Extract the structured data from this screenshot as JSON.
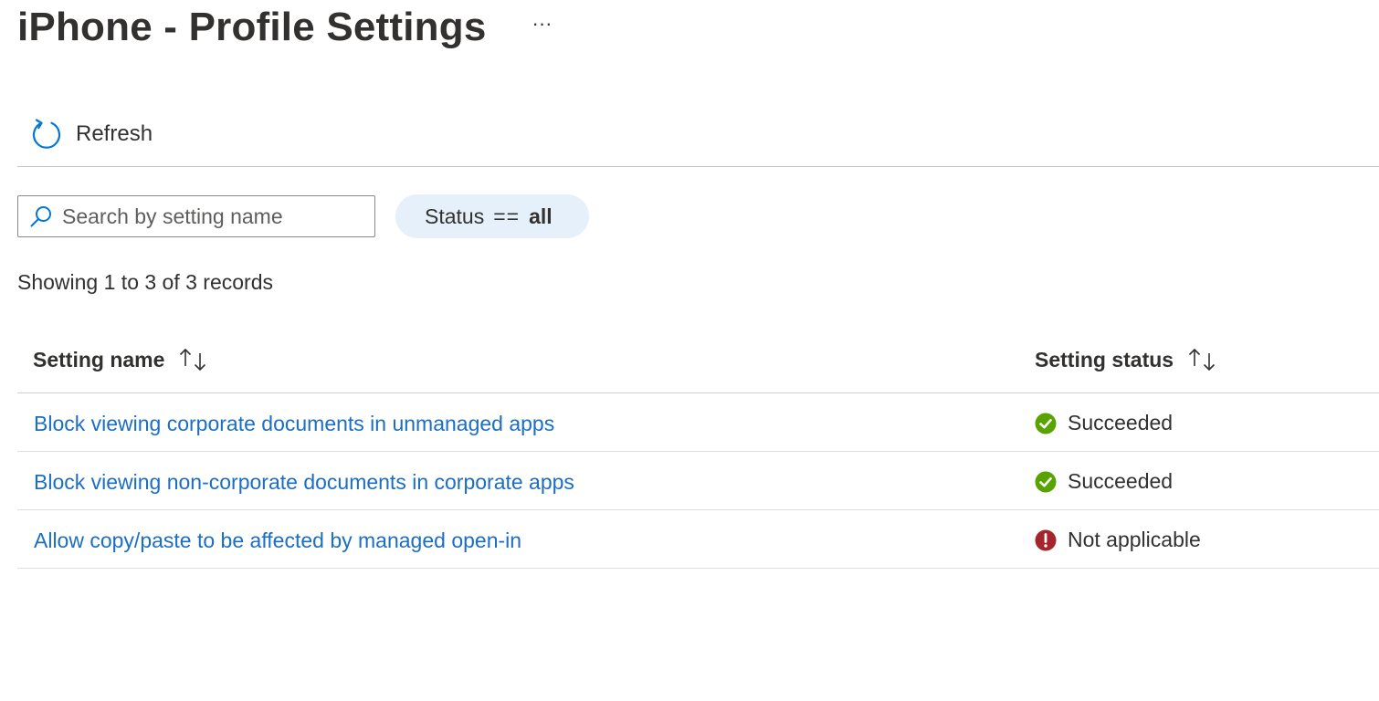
{
  "header": {
    "title": "iPhone - Profile Settings",
    "more_label": "···"
  },
  "toolbar": {
    "refresh_label": "Refresh",
    "refresh_icon": "refresh-icon"
  },
  "filters": {
    "search_placeholder": "Search by setting name",
    "search_value": "",
    "status_filter": {
      "field": "Status",
      "operator": "==",
      "value": "all"
    }
  },
  "record_count": "Showing 1 to 3 of 3 records",
  "table": {
    "columns": [
      {
        "label": "Setting name",
        "sortable": true
      },
      {
        "label": "Setting status",
        "sortable": true
      }
    ],
    "rows": [
      {
        "name": "Block viewing corporate documents in unmanaged apps",
        "status": "Succeeded",
        "status_icon": "success-check-icon"
      },
      {
        "name": "Block viewing non-corporate documents in corporate apps",
        "status": "Succeeded",
        "status_icon": "success-check-icon"
      },
      {
        "name": "Allow copy/paste to be affected by managed open-in",
        "status": "Not applicable",
        "status_icon": "error-exclamation-icon"
      }
    ]
  },
  "colors": {
    "link": "#1b6ec2",
    "success": "#57a300",
    "error": "#a4262c",
    "pill_bg": "#e6f0fa",
    "accent": "#0078d4"
  }
}
